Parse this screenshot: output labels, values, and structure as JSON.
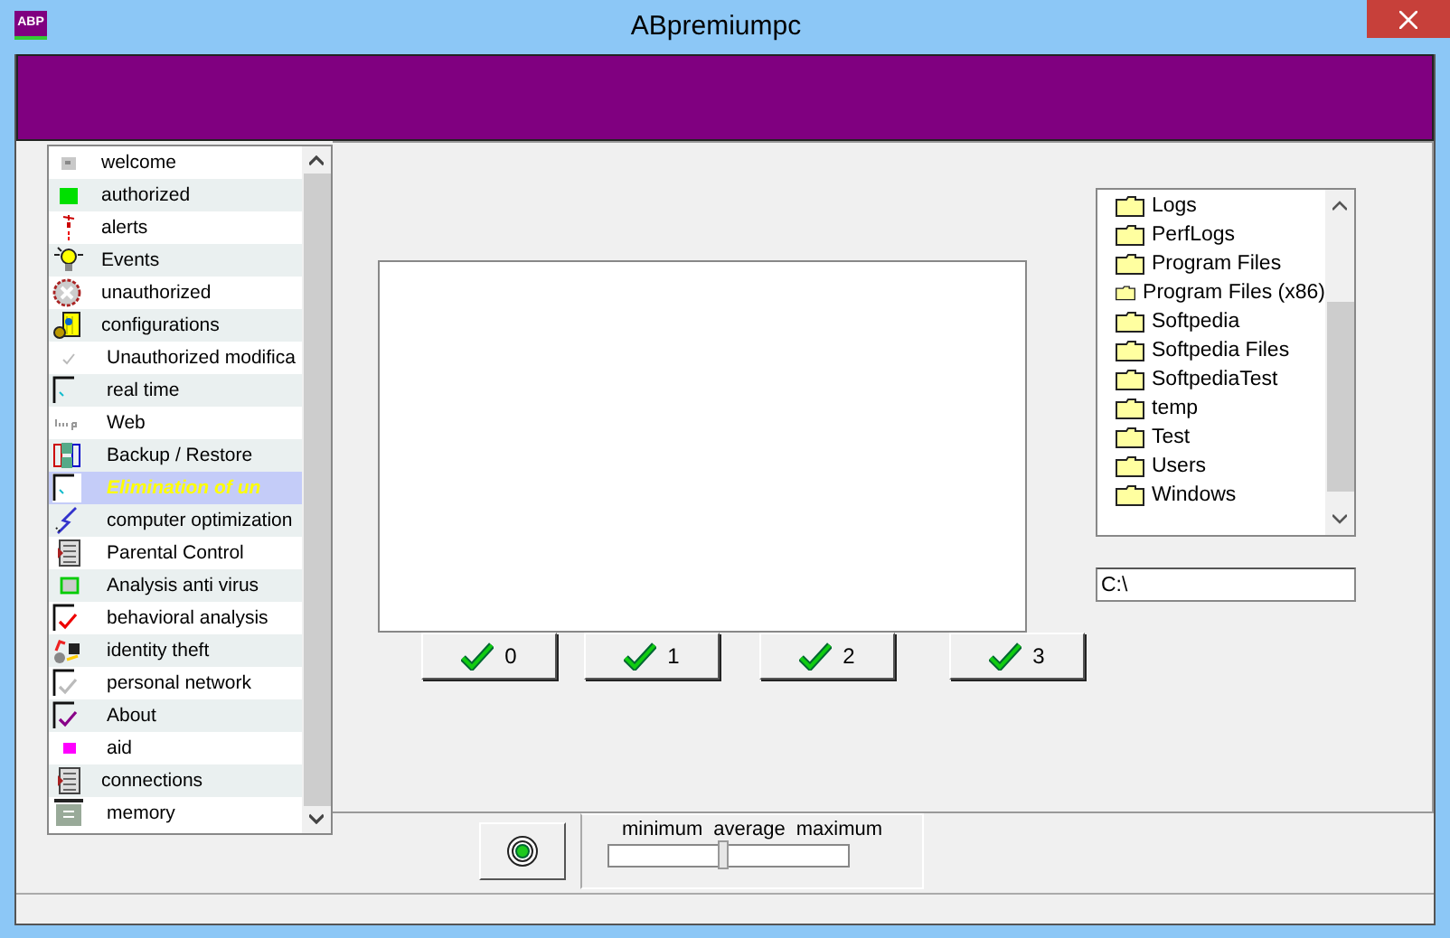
{
  "window": {
    "title": "ABpremiumpc",
    "app_icon": "ABP"
  },
  "sidebar": {
    "items": [
      {
        "label": "welcome",
        "selected": false
      },
      {
        "label": "authorized",
        "selected": false
      },
      {
        "label": "alerts",
        "selected": false
      },
      {
        "label": "Events",
        "selected": false
      },
      {
        "label": "unauthorized",
        "selected": false
      },
      {
        "label": "configurations",
        "selected": false,
        "children": [
          {
            "label": "Unauthorized modifica",
            "selected": false
          },
          {
            "label": "real time",
            "selected": false
          },
          {
            "label": "Web",
            "selected": false
          },
          {
            "label": "Backup / Restore",
            "selected": false
          },
          {
            "label": "Elimination of un",
            "selected": true
          },
          {
            "label": "computer optimization",
            "selected": false
          },
          {
            "label": "Parental Control",
            "selected": false
          },
          {
            "label": "Analysis anti virus",
            "selected": false
          },
          {
            "label": "behavioral analysis",
            "selected": false
          },
          {
            "label": "identity theft",
            "selected": false
          },
          {
            "label": "personal network",
            "selected": false
          },
          {
            "label": "About",
            "selected": false
          },
          {
            "label": "aid",
            "selected": false
          }
        ]
      },
      {
        "label": "connections",
        "selected": false,
        "children": [
          {
            "label": "memory",
            "selected": false
          }
        ]
      }
    ]
  },
  "action_buttons": [
    "0",
    "1",
    "2",
    "3"
  ],
  "folders": [
    "Logs",
    "PerfLogs",
    "Program Files",
    "Program Files (x86)",
    "Softpedia",
    "Softpedia Files",
    "SoftpediaTest",
    "temp",
    "Test",
    "Users",
    "Windows"
  ],
  "path": {
    "value": "C:\\"
  },
  "level_slider": {
    "labels": [
      "minimum",
      "average",
      "maximum"
    ],
    "level": 0.48
  }
}
